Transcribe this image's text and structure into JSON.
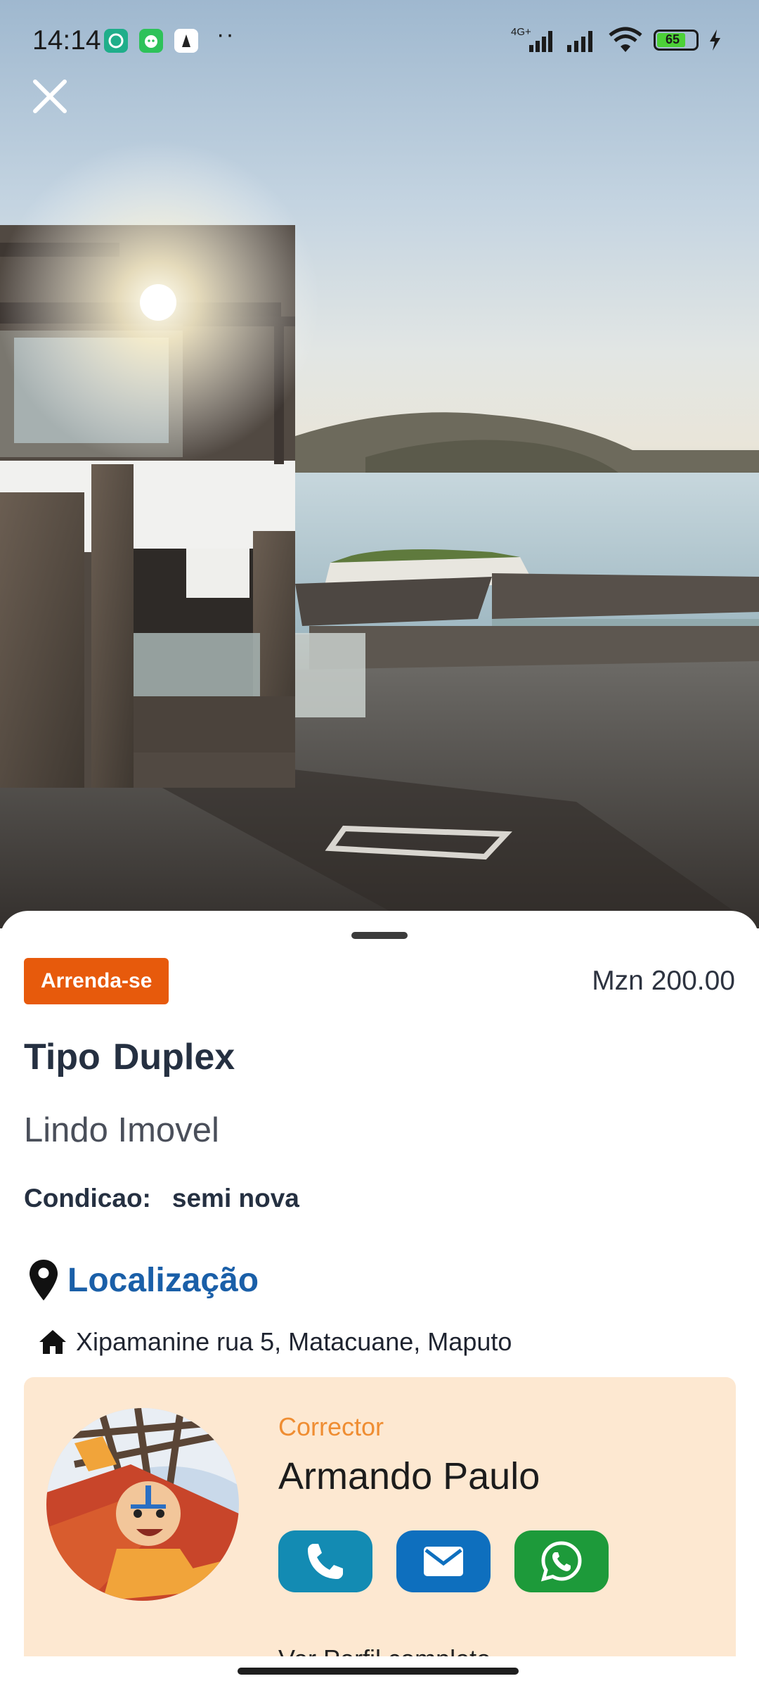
{
  "status_bar": {
    "time": "14:14",
    "network_label": "4G+",
    "battery_level": "65",
    "icons": [
      "whatsapp-icon",
      "chat-app-icon",
      "app-icon",
      "signal-icon",
      "signal-icon",
      "wifi-icon",
      "battery-icon",
      "charging-icon"
    ]
  },
  "hero": {
    "close_icon": "close-icon"
  },
  "listing": {
    "badge": "Arrenda-se",
    "price": "Mzn 200.00",
    "type_label": "Tipo",
    "type_value": "Duplex",
    "title": "Lindo Imovel",
    "condition_label": "Condicao:",
    "condition_value": "semi nova",
    "location_heading": "Localização",
    "address": "Xipamanine rua 5, Matacuane, Maputo"
  },
  "agent": {
    "role": "Corrector",
    "name": "Armando Paulo",
    "profile_link": "Ver Perfil completo",
    "buttons": [
      "phone-icon",
      "mail-icon",
      "whatsapp-icon"
    ]
  },
  "colors": {
    "badge": "#e75a0c",
    "location_heading": "#1a5fa8",
    "card_bg": "#fde8d1",
    "role": "#ef8d32",
    "call_button": "#138bb3",
    "mail_button": "#0e6fbe",
    "whatsapp_button": "#1d9a3a"
  }
}
